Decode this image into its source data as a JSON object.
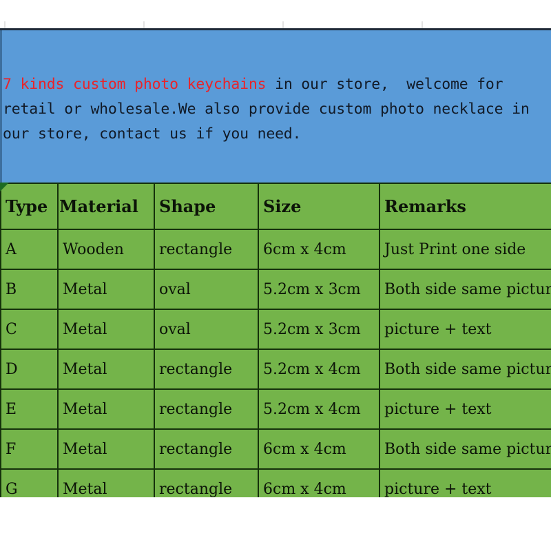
{
  "banner": {
    "highlight_text": "7 kinds custom photo keychains",
    "rest_text": " in our store,  welcome for retail or wholesale.We also provide custom photo necklace in our store, contact us if you need.",
    "background_color": "#5a9bd8",
    "highlight_color": "#e8242a",
    "text_color": "#111a27"
  },
  "table": {
    "background_color": "#74b44a",
    "border_color": "#15310b",
    "headers": [
      "Type",
      "Material",
      "Shape",
      "Size",
      "Remarks"
    ],
    "rows": [
      {
        "type": "A",
        "material": "Wooden",
        "shape": "rectangle",
        "size": "6cm x 4cm",
        "remarks": "Just Print one side"
      },
      {
        "type": "B",
        "material": "Metal",
        "shape": "oval",
        "size": "5.2cm x 3cm",
        "remarks": "Both side same picture"
      },
      {
        "type": "C",
        "material": "Metal",
        "shape": "oval",
        "size": "5.2cm x 3cm",
        "remarks": "picture + text"
      },
      {
        "type": "D",
        "material": "Metal",
        "shape": "rectangle",
        "size": "5.2cm x 4cm",
        "remarks": "Both side same picture"
      },
      {
        "type": "E",
        "material": "Metal",
        "shape": "rectangle",
        "size": "5.2cm x 4cm",
        "remarks": "picture + text"
      },
      {
        "type": "F",
        "material": "Metal",
        "shape": "rectangle",
        "size": "6cm x 4cm",
        "remarks": "Both side same picture"
      },
      {
        "type": "G",
        "material": "Metal",
        "shape": "rectangle",
        "size": "6cm x 4cm",
        "remarks": "picture + text"
      }
    ]
  }
}
